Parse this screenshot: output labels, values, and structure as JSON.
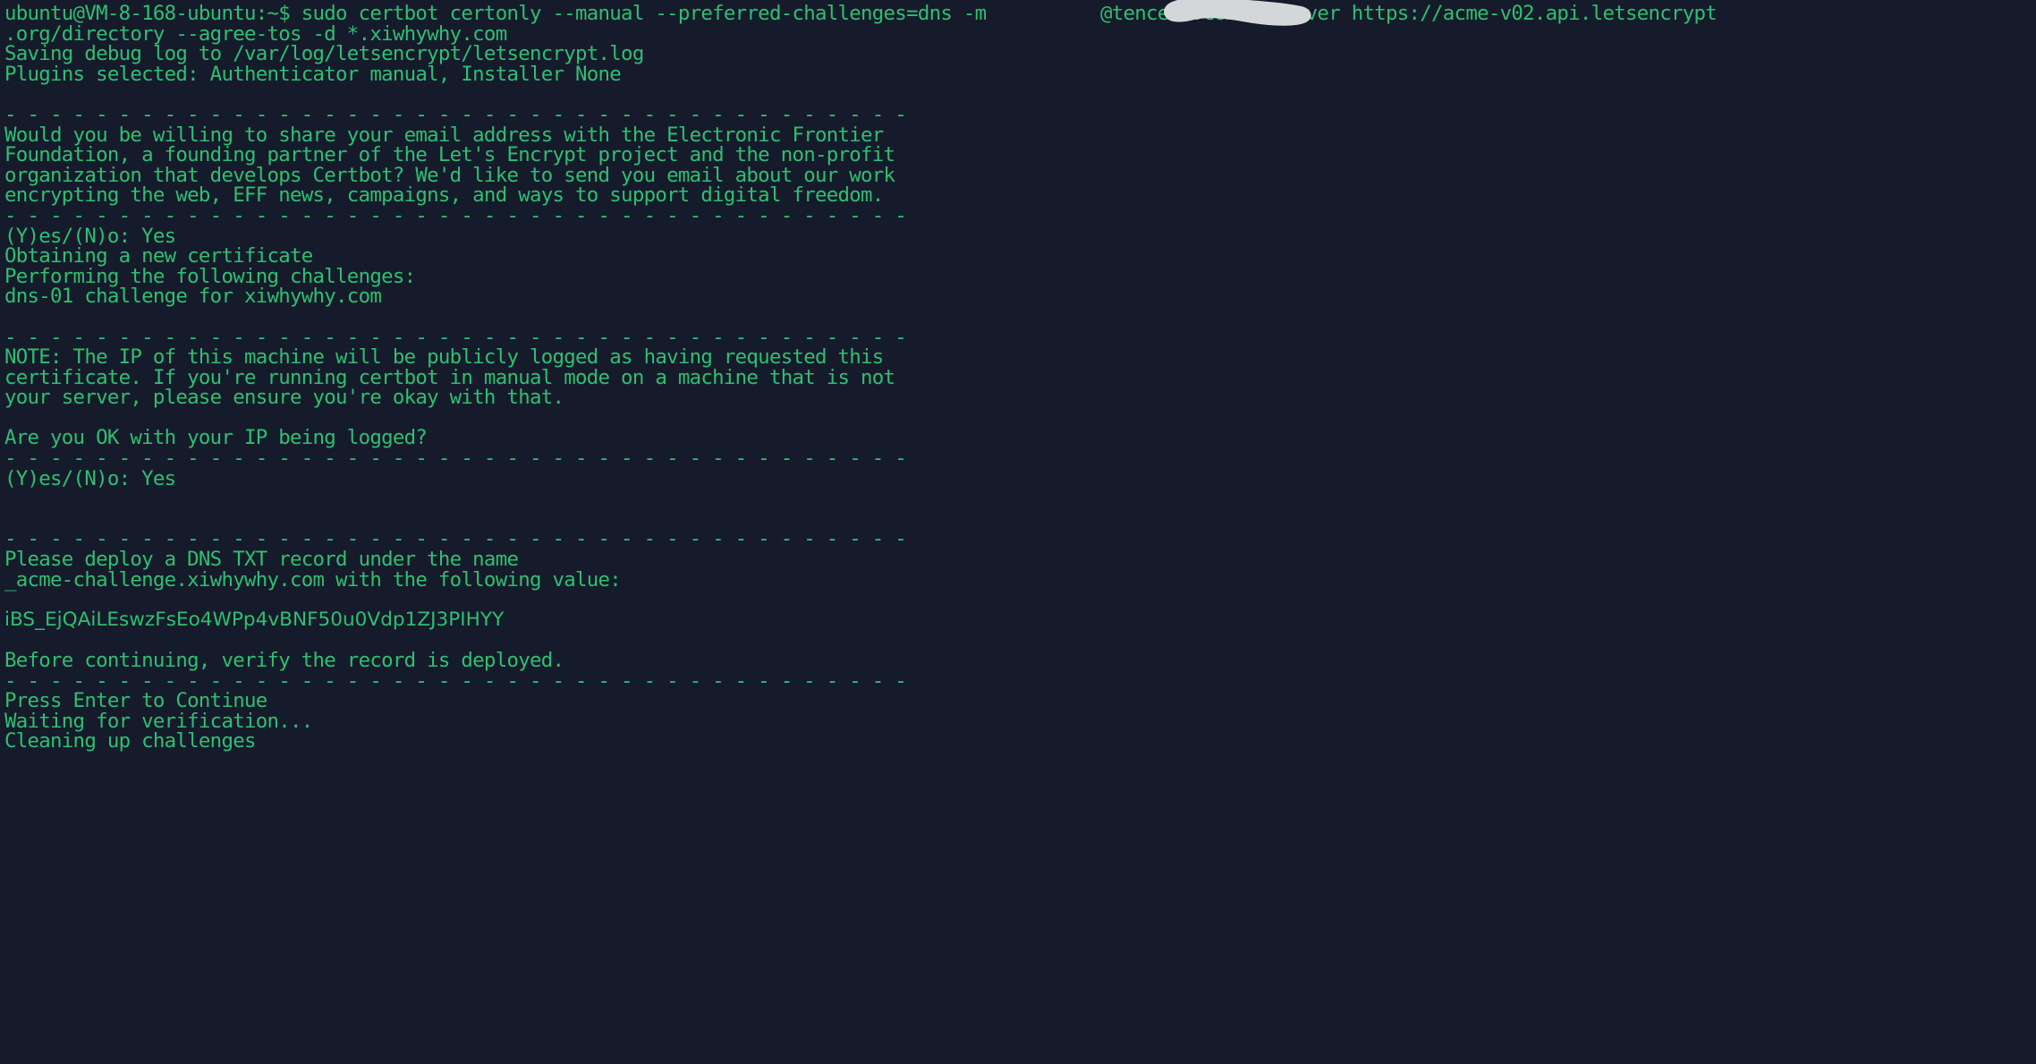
{
  "terminal": {
    "background_color": "#161b2b",
    "foreground_color": "#2fbf71",
    "redaction_color": "#d4d7d9",
    "prompt": "ubuntu@VM-8-168-ubuntu:~$",
    "user": "ubuntu",
    "host": "VM-8-168-ubuntu",
    "cwd": "~",
    "columns": 225,
    "rows": 53
  },
  "command": {
    "full": "sudo certbot certonly --manual --preferred-challenges=dns -m        @tencent.com --server https://acme-v02.api.letsencrypt.org/directory --agree-tos -d *.xiwhywhy.com",
    "program": "certbot",
    "subcommand": "certonly",
    "flags": [
      "--manual",
      "--preferred-challenges=dns",
      "-m",
      "--server",
      "--agree-tos",
      "-d"
    ],
    "email_domain": "@tencent.com",
    "acme_server": "https://acme-v02.api.letsencrypt.org/directory",
    "domain": "*.xiwhywhy.com"
  },
  "lines": [
    {
      "id": "cmd-line-1",
      "text": "ubuntu@VM-8-168-ubuntu:~$ sudo certbot certonly --manual --preferred-challenges=dns -m          @tencent.com --server https://acme-v02.api.letsencrypt"
    },
    {
      "id": "cmd-line-2",
      "text": ".org/directory --agree-tos -d *.xiwhywhy.com"
    },
    {
      "id": "debug-log",
      "text": "Saving debug log to /var/log/letsencrypt/letsencrypt.log"
    },
    {
      "id": "plugins",
      "text": "Plugins selected: Authenticator manual, Installer None"
    },
    {
      "id": "blank-1",
      "text": " "
    },
    {
      "id": "sep-1",
      "text": "- - - - - - - - - - - - - - - - - - - - - - - - - - - - - - - - - - - - - - - -"
    },
    {
      "id": "eff-1",
      "text": "Would you be willing to share your email address with the Electronic Frontier"
    },
    {
      "id": "eff-2",
      "text": "Foundation, a founding partner of the Let's Encrypt project and the non-profit"
    },
    {
      "id": "eff-3",
      "text": "organization that develops Certbot? We'd like to send you email about our work"
    },
    {
      "id": "eff-4",
      "text": "encrypting the web, EFF news, campaigns, and ways to support digital freedom."
    },
    {
      "id": "sep-2",
      "text": "- - - - - - - - - - - - - - - - - - - - - - - - - - - - - - - - - - - - - - - -"
    },
    {
      "id": "answer-1",
      "text": "(Y)es/(N)o: Yes"
    },
    {
      "id": "obtaining",
      "text": "Obtaining a new certificate"
    },
    {
      "id": "performing",
      "text": "Performing the following challenges:"
    },
    {
      "id": "dns-challenge",
      "text": "dns-01 challenge for xiwhywhy.com"
    },
    {
      "id": "blank-2",
      "text": " "
    },
    {
      "id": "sep-3",
      "text": "- - - - - - - - - - - - - - - - - - - - - - - - - - - - - - - - - - - - - - - -"
    },
    {
      "id": "note-1",
      "text": "NOTE: The IP of this machine will be publicly logged as having requested this"
    },
    {
      "id": "note-2",
      "text": "certificate. If you're running certbot in manual mode on a machine that is not"
    },
    {
      "id": "note-3",
      "text": "your server, please ensure you're okay with that."
    },
    {
      "id": "blank-3",
      "text": " "
    },
    {
      "id": "ip-question",
      "text": "Are you OK with your IP being logged?"
    },
    {
      "id": "sep-4",
      "text": "- - - - - - - - - - - - - - - - - - - - - - - - - - - - - - - - - - - - - - - -"
    },
    {
      "id": "answer-2",
      "text": "(Y)es/(N)o: Yes"
    },
    {
      "id": "blank-4",
      "text": " "
    },
    {
      "id": "blank-5",
      "text": " "
    },
    {
      "id": "sep-5",
      "text": "- - - - - - - - - - - - - - - - - - - - - - - - - - - - - - - - - - - - - - - -"
    },
    {
      "id": "deploy-1",
      "text": "Please deploy a DNS TXT record under the name"
    },
    {
      "id": "deploy-2",
      "text": "_acme-challenge.xiwhywhy.com with the following value:"
    },
    {
      "id": "blank-6",
      "text": " "
    },
    {
      "id": "txt-token",
      "text": "iBS_EjQAiLEswzFsEo4WPp4vBNF50u0Vdp1ZJ3PIHYY"
    },
    {
      "id": "blank-7",
      "text": " "
    },
    {
      "id": "before-cont",
      "text": "Before continuing, verify the record is deployed."
    },
    {
      "id": "sep-6",
      "text": "- - - - - - - - - - - - - - - - - - - - - - - - - - - - - - - - - - - - - - - -"
    },
    {
      "id": "press-enter",
      "text": "Press Enter to Continue"
    },
    {
      "id": "waiting",
      "text": "Waiting for verification..."
    },
    {
      "id": "cleaning",
      "text": "Cleaning up challenges"
    }
  ],
  "dns_record": {
    "type": "TXT",
    "name": "_acme-challenge.xiwhywhy.com",
    "value": "iBS_EjQAiLEswzFsEo4WPp4vBNF50u0Vdp1ZJ3PIHYY"
  },
  "prompts": {
    "eff_answer": "Yes",
    "ip_answer": "Yes",
    "choice_format": "(Y)es/(N)o"
  },
  "status": {
    "log_path": "/var/log/letsencrypt/letsencrypt.log",
    "authenticator": "manual",
    "installer": "None",
    "challenge": "dns-01",
    "challenge_domain": "xiwhywhy.com",
    "last_message": "Cleaning up challenges"
  }
}
